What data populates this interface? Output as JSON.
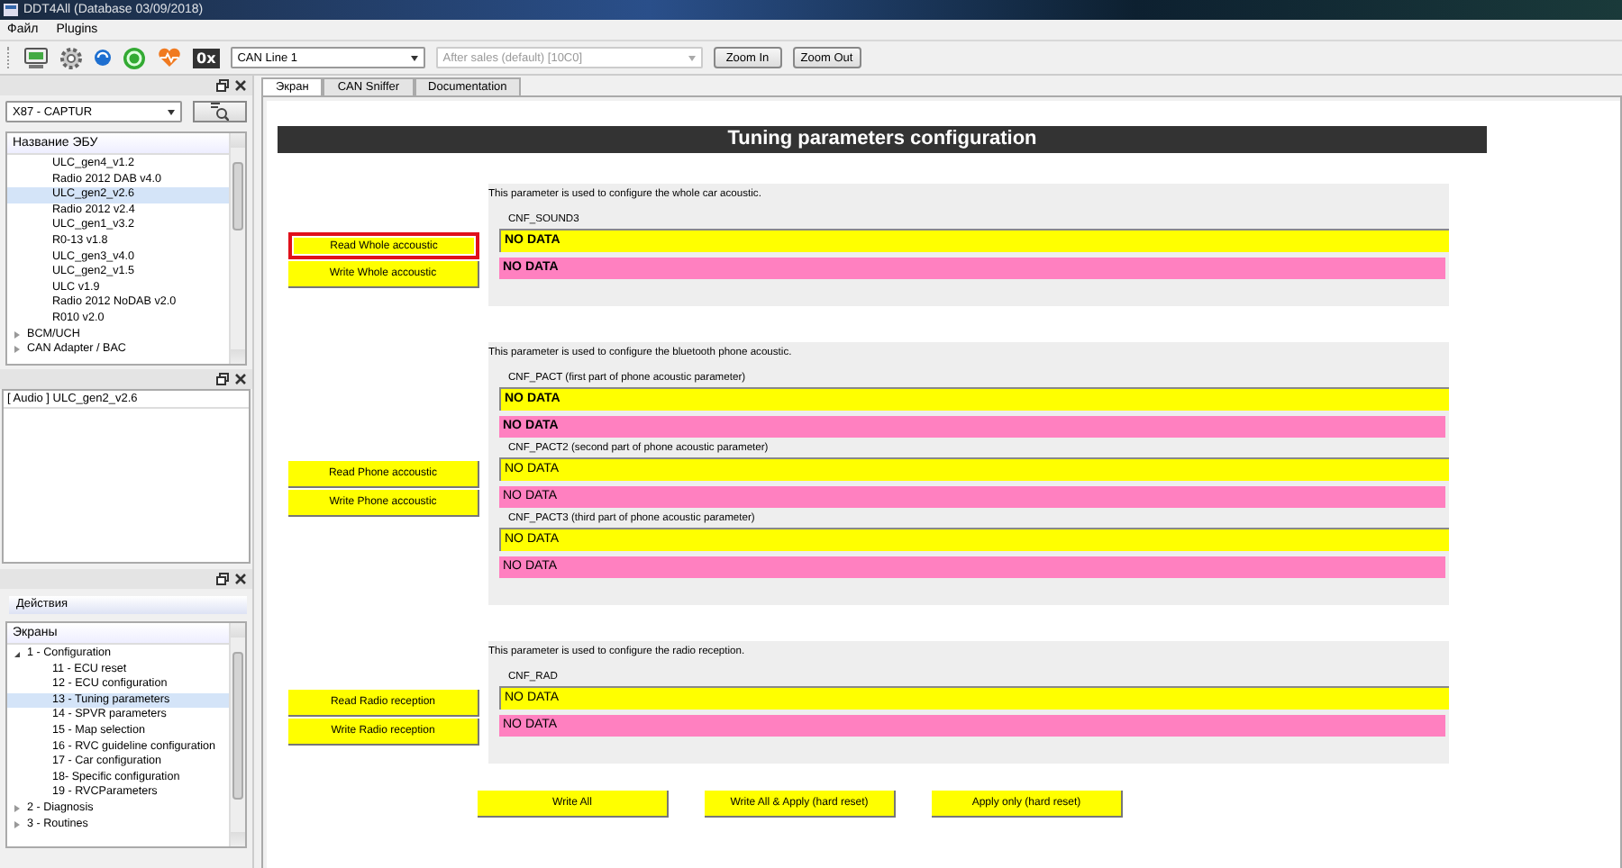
{
  "window": {
    "title": "DDT4All (Database 03/09/2018)"
  },
  "menu": [
    "Файл",
    "Plugins"
  ],
  "toolbar": {
    "hex_label": "0x",
    "can_line": "CAN Line 1",
    "session": "After sales (default) [10C0]",
    "session_disabled": true,
    "buttons": [
      "Zoom In",
      "Zoom Out"
    ]
  },
  "ecu_panel": {
    "vehicle": "X87 - CAPTUR",
    "header": "Название ЭБУ",
    "items": [
      {
        "children": [
          {
            "label": "ULC_gen4_v1.2",
            "selected": false
          },
          {
            "label": "Radio 2012 DAB v4.0",
            "selected": false
          },
          {
            "label": "ULC_gen2_v2.6",
            "selected": true
          },
          {
            "label": "Radio 2012 v2.4",
            "selected": false
          },
          {
            "label": "ULC_gen1_v3.2",
            "selected": false
          },
          {
            "label": "R0-13 v1.8",
            "selected": false
          },
          {
            "label": "ULC_gen3_v4.0",
            "selected": false
          },
          {
            "label": "ULC_gen2_v1.5",
            "selected": false
          },
          {
            "label": "ULC v1.9",
            "selected": false
          },
          {
            "label": "Radio 2012 NoDAB v2.0",
            "selected": false
          },
          {
            "label": "R010 v2.0",
            "selected": false
          }
        ]
      },
      {
        "label": "BCM/UCH",
        "selected": false,
        "expanded": false
      },
      {
        "label": "CAN Adapter / BAC",
        "selected": false,
        "expanded": false
      }
    ]
  },
  "loaded_panel": {
    "items": [
      "[ Audio ] ULC_gen2_v2.6"
    ]
  },
  "actions_panel": {
    "tab": "Действия",
    "header": "Экраны",
    "items": [
      {
        "label": "1 - Configuration",
        "selected": false,
        "expanded": true,
        "children": [
          {
            "label": "11 - ECU reset",
            "selected": false
          },
          {
            "label": "12 - ECU configuration",
            "selected": false
          },
          {
            "label": "13 - Tuning parameters",
            "selected": true
          },
          {
            "label": "14 - SPVR parameters",
            "selected": false
          },
          {
            "label": "15 - Map selection",
            "selected": false
          },
          {
            "label": "16 - RVC guideline configuration",
            "selected": false
          },
          {
            "label": "17 - Car configuration",
            "selected": false
          },
          {
            "label": "18- Specific configuration",
            "selected": false
          },
          {
            "label": "19 - RVCParameters",
            "selected": false
          }
        ]
      },
      {
        "label": "2 - Diagnosis",
        "selected": false,
        "expanded": false
      },
      {
        "label": "3 - Routines",
        "selected": false,
        "expanded": false
      }
    ]
  },
  "tabs": [
    {
      "label": "Экран",
      "selected": true
    },
    {
      "label": "CAN Sniffer",
      "selected": false
    },
    {
      "label": "Documentation",
      "selected": false
    }
  ],
  "screen": {
    "title": "Tuning parameters configuration",
    "sections": [
      {
        "description": "This parameter is used to configure the whole car acoustic.",
        "buttons": [
          {
            "label": "Read Whole accoustic",
            "highlighted": true
          },
          {
            "label": "Write Whole accoustic",
            "highlighted": false
          }
        ],
        "params": [
          {
            "label": "CNF_SOUND3",
            "fields": [
              {
                "kind": "read",
                "value": "NO DATA",
                "bold": true
              },
              {
                "kind": "write",
                "value": "NO DATA",
                "bold": true
              }
            ]
          }
        ]
      },
      {
        "description": "This parameter is used to configure the bluetooth phone acoustic.",
        "buttons": [
          {
            "label": "Read Phone accoustic",
            "highlighted": false
          },
          {
            "label": "Write Phone accoustic",
            "highlighted": false
          }
        ],
        "params": [
          {
            "label": "CNF_PACT (first part of phone acoustic parameter)",
            "fields": [
              {
                "kind": "read",
                "value": "NO DATA",
                "bold": true
              },
              {
                "kind": "write",
                "value": "NO DATA",
                "bold": true
              }
            ]
          },
          {
            "label": "CNF_PACT2 (second part of phone acoustic parameter)",
            "fields": [
              {
                "kind": "read",
                "value": "NO DATA",
                "bold": false
              },
              {
                "kind": "write",
                "value": "NO DATA",
                "bold": false
              }
            ]
          },
          {
            "label": "CNF_PACT3 (third part of phone acoustic parameter)",
            "fields": [
              {
                "kind": "read",
                "value": "NO DATA",
                "bold": false
              },
              {
                "kind": "write",
                "value": "NO DATA",
                "bold": false
              }
            ]
          }
        ]
      },
      {
        "description": "This parameter is used to configure the radio reception.",
        "buttons": [
          {
            "label": "Read Radio reception",
            "highlighted": false
          },
          {
            "label": "Write Radio reception",
            "highlighted": false
          }
        ],
        "params": [
          {
            "label": "CNF_RAD",
            "fields": [
              {
                "kind": "read",
                "value": "NO DATA",
                "bold": false
              },
              {
                "kind": "write",
                "value": "NO DATA",
                "bold": false
              }
            ]
          }
        ]
      }
    ],
    "bottom_buttons": [
      "Write All",
      "Write All & Apply (hard reset)",
      "Apply only (hard reset)"
    ]
  }
}
